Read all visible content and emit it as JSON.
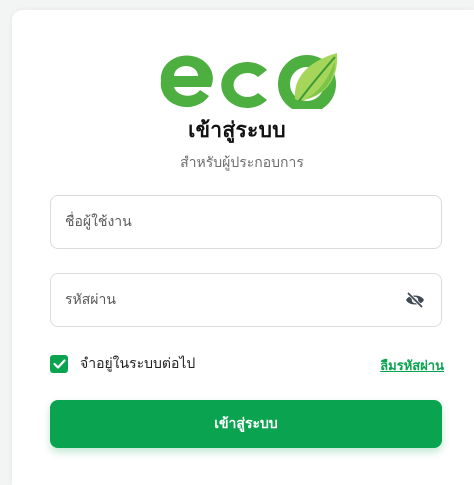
{
  "brand": {
    "logo_text": "eco",
    "color": "#4caf3f",
    "leaf_light": "#a5d65a",
    "leaf_dark": "#3a9a3a"
  },
  "header": {
    "title": "เข้าสู่ระบบ",
    "subtitle": "สำหรับผู้ประกอบการ"
  },
  "form": {
    "username_placeholder": "ชื่อผู้ใช้งาน",
    "password_placeholder": "รหัสผ่าน",
    "password_toggle_icon": "eye-off-icon",
    "remember_label": "จำอยู่ในระบบต่อไป",
    "remember_checked": true,
    "forgot_link": "ลืมรหัสผ่าน",
    "submit_label": "เข้าสู่ระบบ"
  },
  "colors": {
    "accent": "#0aa34f",
    "border": "#d9dcdf",
    "background": "#f3f4f4"
  }
}
